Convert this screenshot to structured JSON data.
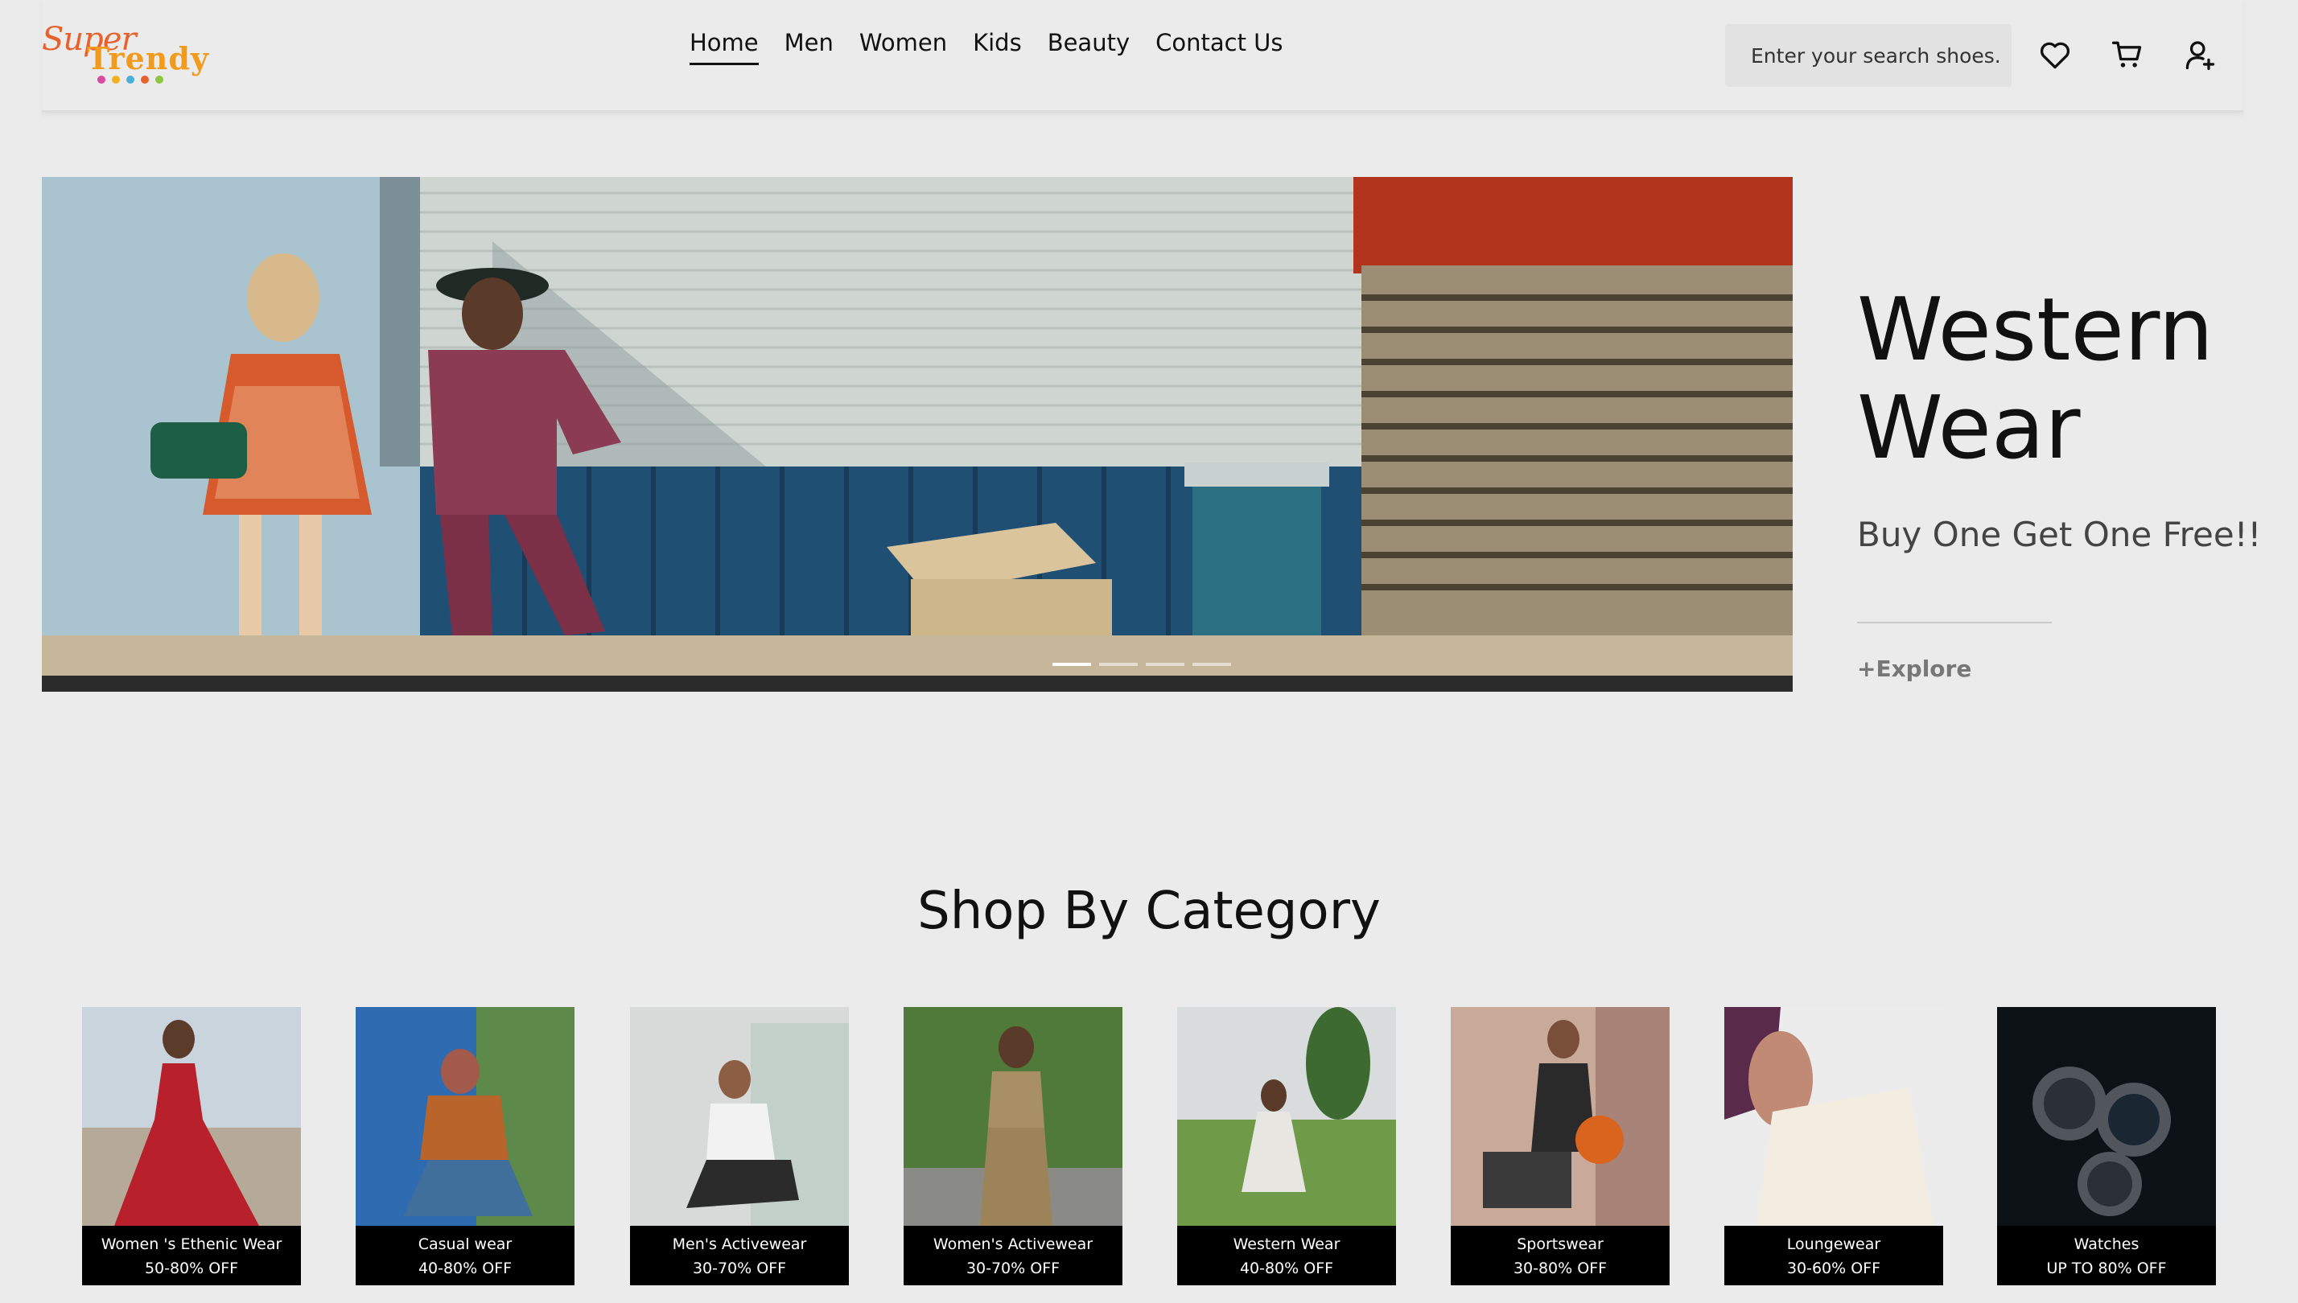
{
  "header": {
    "logo": {
      "line1": "Super",
      "line2": "Trendy"
    },
    "nav": [
      "Home",
      "Men",
      "Women",
      "Kids",
      "Beauty",
      "Contact Us"
    ],
    "active_nav": "Home",
    "search_placeholder": "Enter your search shoes.",
    "icons": [
      "heart-icon",
      "cart-icon",
      "user-add-icon"
    ]
  },
  "hero": {
    "title_line1": "Western",
    "title_line2": "Wear",
    "subtitle": "Buy One Get One Free!!",
    "cta": "+Explore",
    "slides_total": 4,
    "active_slide": 1
  },
  "category": {
    "title": "Shop By Category",
    "items": [
      {
        "name": "Women 's Ethenic Wear",
        "offer": "50-80% OFF"
      },
      {
        "name": "Casual wear",
        "offer": "40-80% OFF"
      },
      {
        "name": "Men's Activewear",
        "offer": "30-70% OFF"
      },
      {
        "name": "Women's Activewear",
        "offer": "30-70% OFF"
      },
      {
        "name": "Western Wear",
        "offer": "40-80% OFF"
      },
      {
        "name": "Sportswear",
        "offer": "30-80% OFF"
      },
      {
        "name": "Loungewear",
        "offer": "30-60% OFF"
      },
      {
        "name": "Watches",
        "offer": "UP TO 80% OFF"
      }
    ]
  },
  "colors": {
    "background": "#ebebeb",
    "logo_orange": "#e8602c",
    "logo_yellow": "#f29a1c",
    "label_bg": "#000000"
  }
}
